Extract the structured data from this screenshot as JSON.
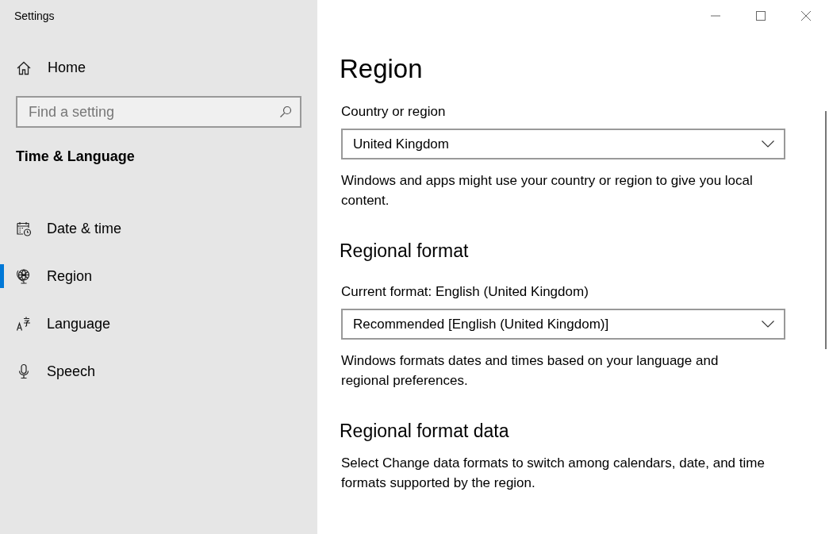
{
  "window": {
    "title": "Settings"
  },
  "sidebar": {
    "home": "Home",
    "search": {
      "placeholder": "Find a setting"
    },
    "section": "Time & Language",
    "items": [
      {
        "label": "Date & time",
        "kind": "calendar",
        "selected": false
      },
      {
        "label": "Region",
        "kind": "globe",
        "selected": true
      },
      {
        "label": "Language",
        "kind": "language",
        "selected": false
      },
      {
        "label": "Speech",
        "kind": "microphone",
        "selected": false
      }
    ]
  },
  "page": {
    "title": "Region",
    "blocks": [
      {
        "kind": "label",
        "text": "Country or region"
      },
      {
        "kind": "dropdown",
        "text": "United Kingdom"
      },
      {
        "kind": "text",
        "text": "Windows and apps might use your country or region to give you local content."
      },
      {
        "kind": "heading",
        "text": "Regional format"
      },
      {
        "kind": "label",
        "text": "Current format: English (United Kingdom)"
      },
      {
        "kind": "dropdown",
        "text": "Recommended [English (United Kingdom)]"
      },
      {
        "kind": "text",
        "text": "Windows formats dates and times based on your language and regional preferences."
      },
      {
        "kind": "heading",
        "text": "Regional format data"
      },
      {
        "kind": "text",
        "text": "Select Change data formats to switch among calendars, date, and time formats supported by the region."
      }
    ]
  }
}
